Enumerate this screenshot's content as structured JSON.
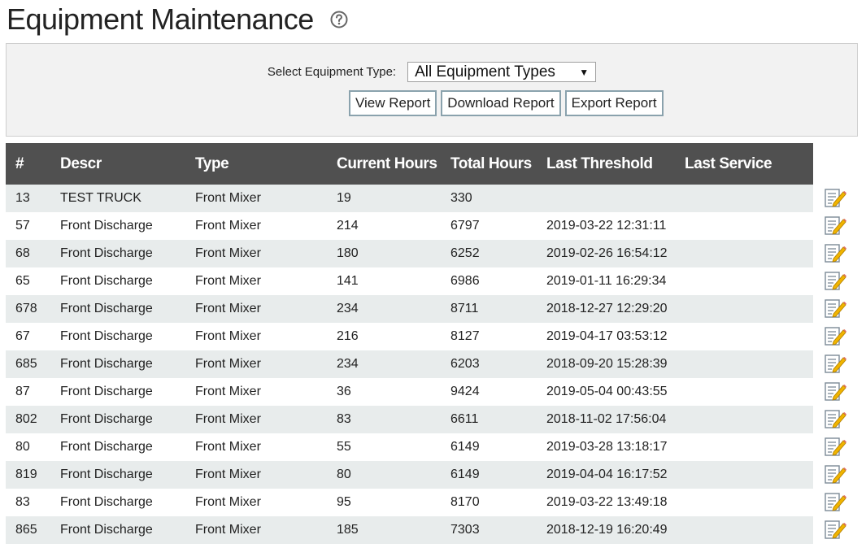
{
  "page": {
    "title": "Equipment Maintenance"
  },
  "filter": {
    "label": "Select Equipment Type:",
    "selected": "All Equipment Types",
    "buttons": {
      "view": "View Report",
      "download": "Download Report",
      "export": "Export Report"
    }
  },
  "table": {
    "headers": [
      "#",
      "Descr",
      "Type",
      "Current Hours",
      "Total Hours",
      "Last Threshold",
      "Last Service"
    ],
    "rows": [
      [
        "13",
        "TEST TRUCK",
        "Front Mixer",
        "19",
        "330",
        "",
        ""
      ],
      [
        "57",
        "Front Discharge",
        "Front Mixer",
        "214",
        "6797",
        "2019-03-22 12:31:11",
        ""
      ],
      [
        "68",
        "Front Discharge",
        "Front Mixer",
        "180",
        "6252",
        "2019-02-26 16:54:12",
        ""
      ],
      [
        "65",
        "Front Discharge",
        "Front Mixer",
        "141",
        "6986",
        "2019-01-11 16:29:34",
        ""
      ],
      [
        "678",
        "Front Discharge",
        "Front Mixer",
        "234",
        "8711",
        "2018-12-27 12:29:20",
        ""
      ],
      [
        "67",
        "Front Discharge",
        "Front Mixer",
        "216",
        "8127",
        "2019-04-17 03:53:12",
        ""
      ],
      [
        "685",
        "Front Discharge",
        "Front Mixer",
        "234",
        "6203",
        "2018-09-20 15:28:39",
        ""
      ],
      [
        "87",
        "Front Discharge",
        "Front Mixer",
        "36",
        "9424",
        "2019-05-04 00:43:55",
        ""
      ],
      [
        "802",
        "Front Discharge",
        "Front Mixer",
        "83",
        "6611",
        "2018-11-02 17:56:04",
        ""
      ],
      [
        "80",
        "Front Discharge",
        "Front Mixer",
        "55",
        "6149",
        "2019-03-28 13:18:17",
        ""
      ],
      [
        "819",
        "Front Discharge",
        "Front Mixer",
        "80",
        "6149",
        "2019-04-04 16:17:52",
        ""
      ],
      [
        "83",
        "Front Discharge",
        "Front Mixer",
        "95",
        "8170",
        "2019-03-22 13:49:18",
        ""
      ],
      [
        "865",
        "Front Discharge",
        "Front Mixer",
        "185",
        "7303",
        "2018-12-19 16:20:49",
        ""
      ]
    ]
  },
  "icons": {
    "help": "help-circle-icon",
    "edit": "edit-note-icon",
    "dropdown": "triangle-down-icon"
  },
  "colors": {
    "header_bg": "#505050",
    "row_alt_bg": "#e8ecec",
    "panel_bg": "#f2f2f2",
    "button_border": "#8aa2ad",
    "edit_icon_accent": "#f0b400"
  }
}
